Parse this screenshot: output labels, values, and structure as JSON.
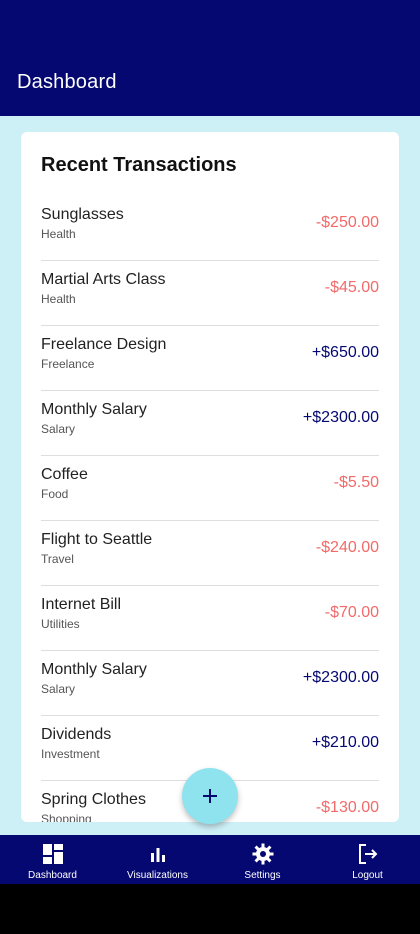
{
  "appbar": {
    "title": "Dashboard"
  },
  "card": {
    "title": "Recent Transactions"
  },
  "transactions": [
    {
      "name": "Sunglasses",
      "category": "Health",
      "amount": "-$250.00",
      "type": "expense"
    },
    {
      "name": "Martial Arts Class",
      "category": "Health",
      "amount": "-$45.00",
      "type": "expense"
    },
    {
      "name": "Freelance Design",
      "category": "Freelance",
      "amount": "+$650.00",
      "type": "income"
    },
    {
      "name": "Monthly Salary",
      "category": "Salary",
      "amount": "+$2300.00",
      "type": "income"
    },
    {
      "name": "Coffee",
      "category": "Food",
      "amount": "-$5.50",
      "type": "expense"
    },
    {
      "name": "Flight to Seattle",
      "category": "Travel",
      "amount": "-$240.00",
      "type": "expense"
    },
    {
      "name": "Internet Bill",
      "category": "Utilities",
      "amount": "-$70.00",
      "type": "expense"
    },
    {
      "name": "Monthly Salary",
      "category": "Salary",
      "amount": "+$2300.00",
      "type": "income"
    },
    {
      "name": "Dividends",
      "category": "Investment",
      "amount": "+$210.00",
      "type": "income"
    },
    {
      "name": "Spring Clothes",
      "category": "Shopping",
      "amount": "-$130.00",
      "type": "expense"
    }
  ],
  "fab": {
    "icon": "plus-icon"
  },
  "nav": [
    {
      "label": "Dashboard",
      "icon": "dashboard-icon"
    },
    {
      "label": "Visualizations",
      "icon": "bar-chart-icon"
    },
    {
      "label": "Settings",
      "icon": "gear-icon"
    },
    {
      "label": "Logout",
      "icon": "logout-icon"
    }
  ],
  "colors": {
    "primary": "#050871",
    "background": "#cdeff6",
    "expense": "#f26a6a",
    "income": "#050871",
    "fab": "#8ee3ee"
  }
}
